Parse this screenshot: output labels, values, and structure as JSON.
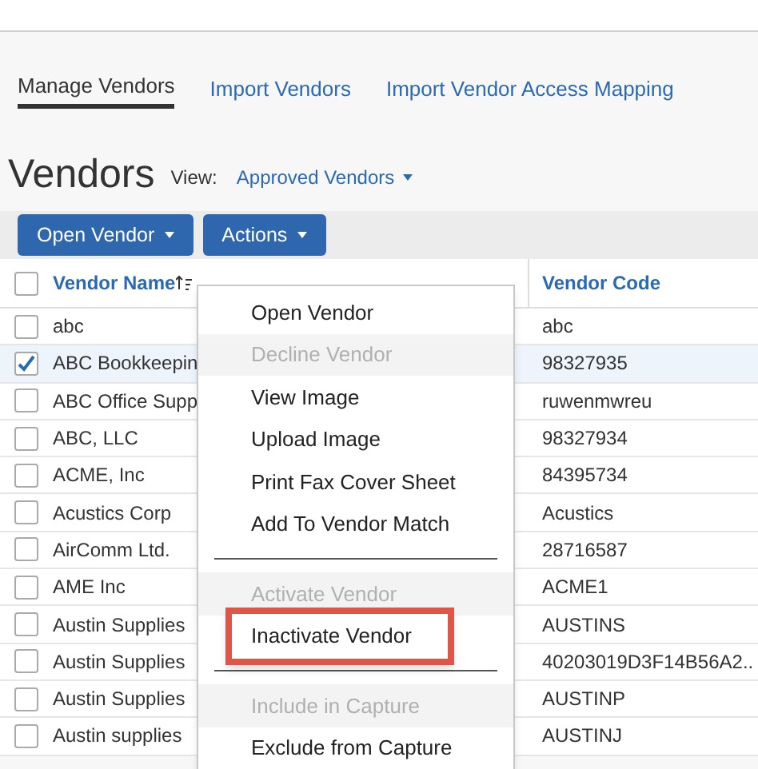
{
  "tabs": [
    {
      "label": "Manage Vendors",
      "selected": true
    },
    {
      "label": "Import Vendors",
      "selected": false
    },
    {
      "label": "Import Vendor Access Mapping",
      "selected": false
    }
  ],
  "heading": "Vendors",
  "view": {
    "label": "View:",
    "value": "Approved Vendors"
  },
  "toolbar": [
    "Open Vendor",
    "Actions"
  ],
  "table": {
    "columns": [
      "Vendor Name",
      "Vendor Code"
    ],
    "all_checked": false,
    "rows": [
      {
        "name": "abc",
        "code": "abc",
        "checked": false
      },
      {
        "name": "ABC Bookkeepin",
        "code": "98327935",
        "checked": true
      },
      {
        "name": "ABC Office Supp",
        "code": "ruwenmwreu",
        "checked": false
      },
      {
        "name": "ABC, LLC",
        "code": "98327934",
        "checked": false
      },
      {
        "name": "ACME, Inc",
        "code": "84395734",
        "checked": false
      },
      {
        "name": "Acustics Corp",
        "code": "Acustics",
        "checked": false
      },
      {
        "name": "AirComm Ltd.",
        "code": "28716587",
        "checked": false
      },
      {
        "name": "AME Inc",
        "code": "ACME1",
        "checked": false
      },
      {
        "name": "Austin Supplies",
        "code": "AUSTINS",
        "checked": false
      },
      {
        "name": "Austin Supplies",
        "code": "40203019D3F14B56A2..",
        "checked": false
      },
      {
        "name": "Austin Supplies",
        "code": "AUSTINP",
        "checked": false
      },
      {
        "name": "Austin supplies",
        "code": "AUSTINJ",
        "checked": false
      }
    ]
  },
  "menu": [
    {
      "kind": "item",
      "label": "Open Vendor",
      "disabled": false
    },
    {
      "kind": "item",
      "label": "Decline Vendor",
      "disabled": true
    },
    {
      "kind": "item",
      "label": "View Image",
      "disabled": false
    },
    {
      "kind": "item",
      "label": "Upload Image",
      "disabled": false
    },
    {
      "kind": "item",
      "label": "Print Fax Cover Sheet",
      "disabled": false
    },
    {
      "kind": "item",
      "label": "Add To Vendor Match",
      "disabled": false
    },
    {
      "kind": "separator"
    },
    {
      "kind": "item",
      "label": "Activate Vendor",
      "disabled": true
    },
    {
      "kind": "item",
      "label": "Inactivate Vendor",
      "disabled": false,
      "highlighted": true
    },
    {
      "kind": "separator"
    },
    {
      "kind": "item",
      "label": "Include in Capture",
      "disabled": true
    },
    {
      "kind": "item",
      "label": "Exclude from Capture",
      "disabled": false
    }
  ]
}
